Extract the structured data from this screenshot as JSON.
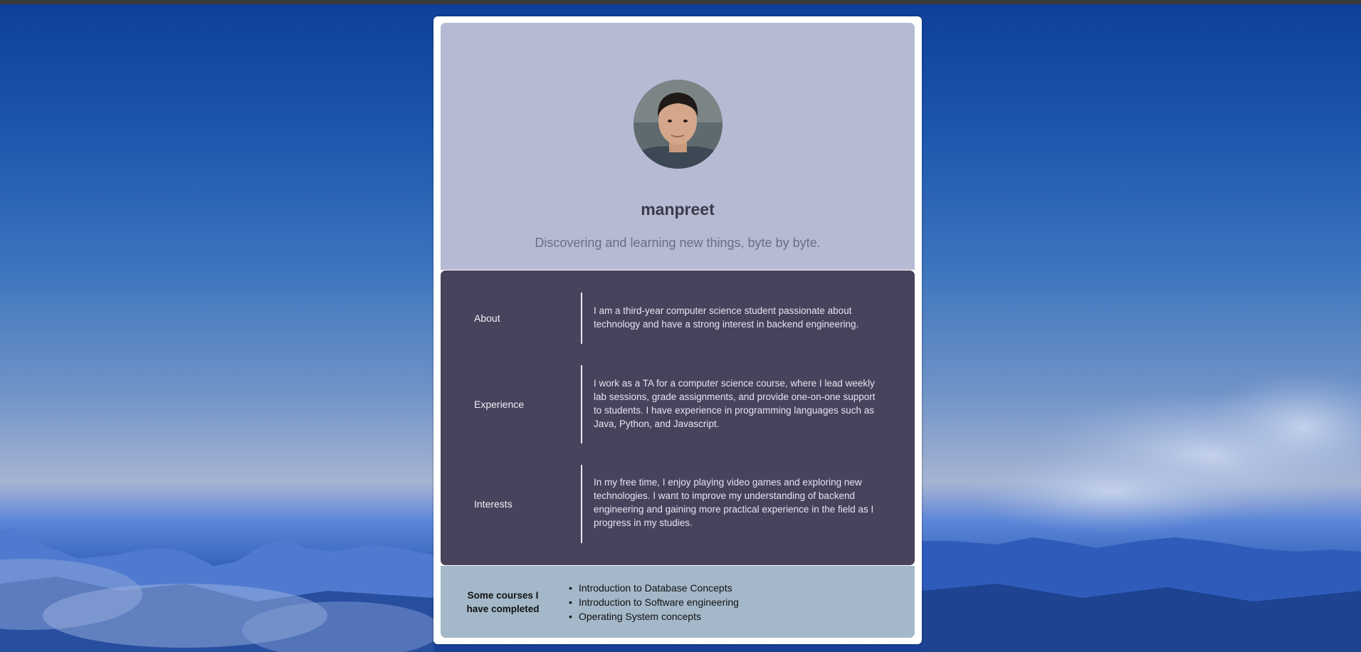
{
  "profile": {
    "name": "manpreet",
    "tagline": "Discovering and learning new things, byte by byte."
  },
  "sections": [
    {
      "label": "About",
      "text": "I am a third-year computer science student passionate about technology and have a strong interest in backend engineering."
    },
    {
      "label": "Experience",
      "text": "I work as a TA for a computer science course, where I lead weekly lab sessions, grade assignments, and provide one-on-one support to students. I have experience in programming languages such as Java, Python, and Javascript."
    },
    {
      "label": "Interests",
      "text": "In my free time, I enjoy playing video games and exploring new technologies. I want to improve my understanding of backend engineering and gaining more practical experience in the field as I progress in my studies."
    }
  ],
  "courses": {
    "heading": "Some courses I have completed",
    "items": [
      "Introduction to Database Concepts",
      "Introduction to Software engineering",
      "Operating System concepts"
    ]
  },
  "colors": {
    "profile_bg": "#b6bad3",
    "details_bg": "#48435c",
    "courses_bg": "#a4b8c9"
  },
  "icons": {
    "avatar": "profile-photo"
  }
}
